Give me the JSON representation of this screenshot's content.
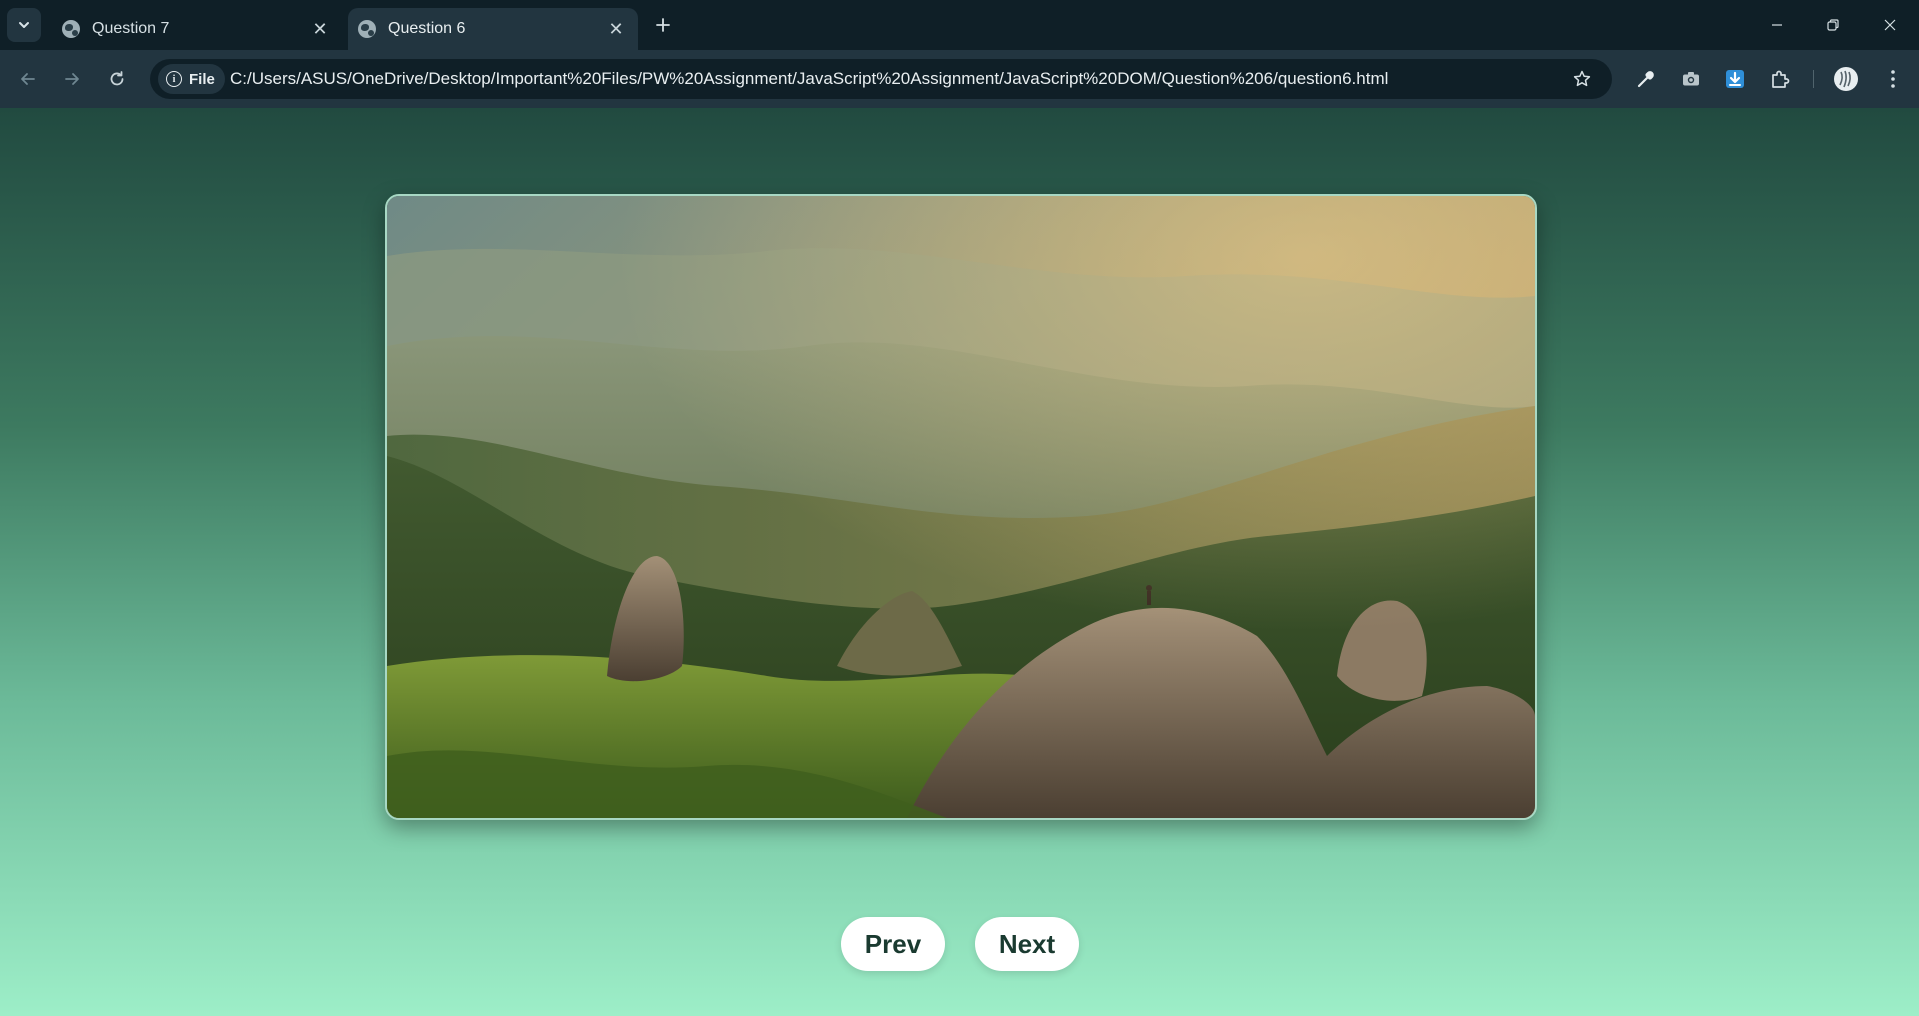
{
  "browser": {
    "tabs": [
      {
        "title": "Question 7",
        "active": false
      },
      {
        "title": "Question 6",
        "active": true
      }
    ],
    "omnibox": {
      "chip_label": "File",
      "url": "C:/Users/ASUS/OneDrive/Desktop/Important%20Files/PW%20Assignment/JavaScript%20Assignment/JavaScript%20DOM/Question%206/question6.html"
    },
    "icons": {
      "tab_search": "chevron-down-icon",
      "tab_favicon": "globe-icon",
      "tab_close": "close-icon",
      "new_tab": "plus-icon",
      "back": "arrow-left-icon",
      "forward": "arrow-right-icon",
      "reload": "reload-icon",
      "bookmark": "star-icon",
      "eyedropper": "eyedropper-icon",
      "camera": "camera-icon",
      "download": "download-icon",
      "extensions": "puzzle-icon",
      "profile": "avatar",
      "menu": "kebab-menu-icon"
    }
  },
  "page": {
    "slide_image_alt": "mountain landscape",
    "buttons": {
      "prev": "Prev",
      "next": "Next"
    },
    "colors": {
      "background_top": "#214a40",
      "background_bottom": "#9deec8",
      "button_text": "#1a3a30"
    }
  }
}
